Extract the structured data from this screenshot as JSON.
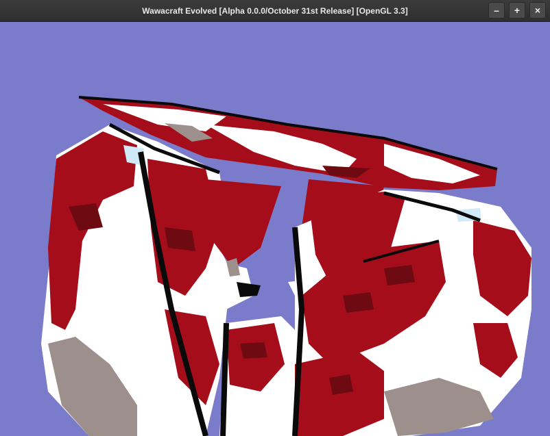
{
  "window": {
    "title": "Wawacraft Evolved [Alpha 0.0.0/October 31st Release] [OpenGL 3.3]",
    "controls": {
      "minimize_symbol": "–",
      "maximize_symbol": "+",
      "close_symbol": "×"
    }
  },
  "viewport": {
    "sky_color": "#7b7bcc",
    "block_colors": {
      "red": "#a50d1b",
      "dark_red": "#6e0a12",
      "white": "#ffffff",
      "gray": "#9c8f8c",
      "light_blue": "#cfe9f6",
      "black": "#0a0a0a"
    }
  }
}
